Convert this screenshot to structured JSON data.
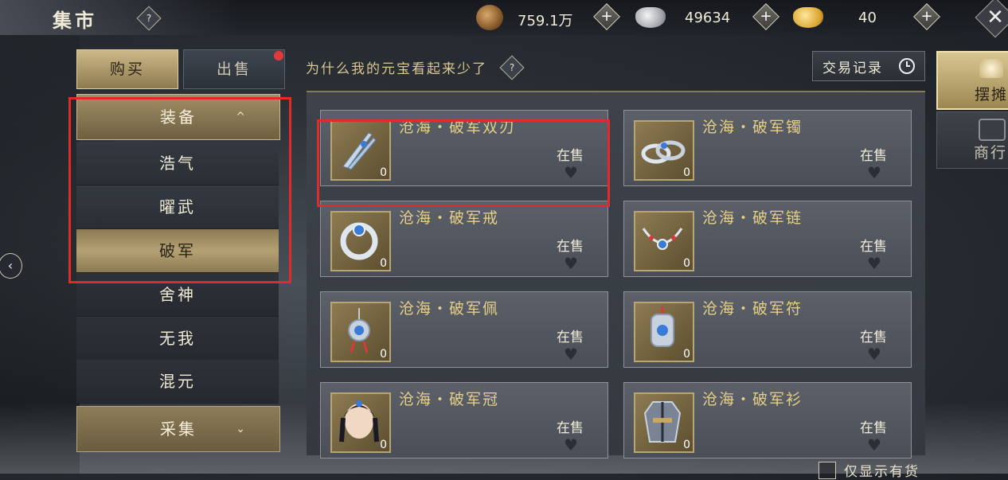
{
  "header": {
    "title": "集市",
    "help": "?",
    "close": "✕"
  },
  "currencies": [
    {
      "icon": "copper-coin-icon",
      "value": "759.1万"
    },
    {
      "icon": "silver-ingot-icon",
      "value": "49634"
    },
    {
      "icon": "gold-ingot-icon",
      "value": "40"
    }
  ],
  "plus": "+",
  "tabs": {
    "buy": "购买",
    "sell": "出售"
  },
  "categories": {
    "header": "装备",
    "header_chevron": "^",
    "subs": [
      "浩气",
      "曜武",
      "破军"
    ],
    "active_sub": "破军",
    "others": [
      "舍神",
      "无我",
      "混元"
    ],
    "footer": "采集",
    "footer_chevron": "⌄"
  },
  "notice": "为什么我的元宝看起来少了",
  "notice_help": "?",
  "history_button": "交易记录",
  "items": [
    {
      "name": "沧海・破军双刃",
      "status": "在售",
      "qty": "0",
      "icon": "twin-blades-icon"
    },
    {
      "name": "沧海・破军镯",
      "status": "在售",
      "qty": "0",
      "icon": "bracelet-icon"
    },
    {
      "name": "沧海・破军戒",
      "status": "在售",
      "qty": "0",
      "icon": "ring-icon"
    },
    {
      "name": "沧海・破军链",
      "status": "在售",
      "qty": "0",
      "icon": "necklace-icon"
    },
    {
      "name": "沧海・破军佩",
      "status": "在售",
      "qty": "0",
      "icon": "pendant-icon"
    },
    {
      "name": "沧海・破军符",
      "status": "在售",
      "qty": "0",
      "icon": "talisman-icon"
    },
    {
      "name": "沧海・破军冠",
      "status": "在售",
      "qty": "0",
      "icon": "crown-icon"
    },
    {
      "name": "沧海・破军衫",
      "status": "在售",
      "qty": "0",
      "icon": "armor-icon"
    }
  ],
  "heart": "♥",
  "side_tabs": {
    "stall": "摆摊",
    "shop": "商行"
  },
  "stock_filter": "仅显示有货",
  "back_arrow": "‹",
  "colors": {
    "accent_gold": "#e7cf86",
    "highlight_red": "#e12a2a",
    "alert_dot": "#e03a3a"
  }
}
